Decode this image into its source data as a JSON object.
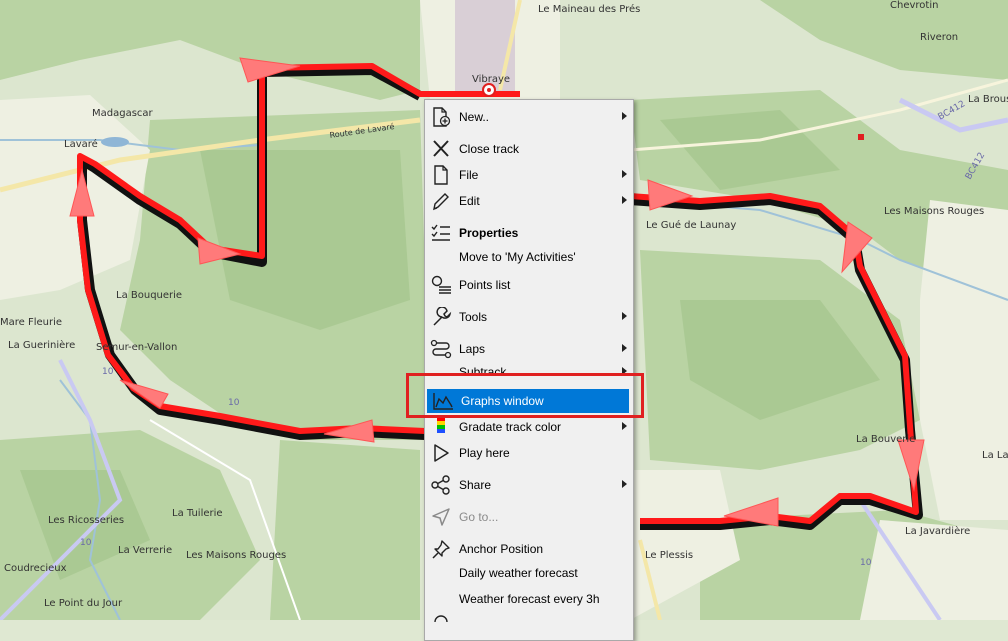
{
  "map": {
    "places": [
      {
        "name": "Le Maineau des Prés"
      },
      {
        "name": "Chevrotin"
      },
      {
        "name": "Riveron"
      },
      {
        "name": "Vibraye"
      },
      {
        "name": "Madagascar"
      },
      {
        "name": "Lavaré"
      },
      {
        "name": "Route de Lavaré"
      },
      {
        "name": "La Brousse"
      },
      {
        "name": "Le Gué de Launay"
      },
      {
        "name": "Les Maisons Rouges"
      },
      {
        "name": "La Bouquerie"
      },
      {
        "name": "Mare Fleurie"
      },
      {
        "name": "La Guerinière"
      },
      {
        "name": "Semur-en-Vallon"
      },
      {
        "name": "La Bouverie"
      },
      {
        "name": "La Lan"
      },
      {
        "name": "La Javardière"
      },
      {
        "name": "Les Ricosseries"
      },
      {
        "name": "La Tuilerie"
      },
      {
        "name": "La Verrerie"
      },
      {
        "name": "Les Maisons Rouges"
      },
      {
        "name": "Coudrecieux"
      },
      {
        "name": "Le Point du Jour"
      },
      {
        "name": "Le Plessis"
      }
    ],
    "road_labels": [
      "BC412",
      "BC412",
      "10",
      "10",
      "10",
      "10"
    ],
    "track_color": "#ff1a1a"
  },
  "menu": {
    "items": [
      {
        "label": "New..",
        "icon": "new-document-icon",
        "submenu": true
      },
      {
        "label": "Close track",
        "icon": "close-icon",
        "submenu": false
      },
      {
        "label": "File",
        "icon": "file-icon",
        "submenu": true
      },
      {
        "label": "Edit",
        "icon": "pencil-icon",
        "submenu": true
      },
      {
        "label": "Properties",
        "icon": "properties-list-icon",
        "submenu": false
      },
      {
        "label": "Move to 'My Activities'",
        "icon": "",
        "submenu": false
      },
      {
        "label": "Points list",
        "icon": "points-list-icon",
        "submenu": false
      },
      {
        "label": "Tools",
        "icon": "wrench-icon",
        "submenu": true
      },
      {
        "label": "Laps",
        "icon": "laps-icon",
        "submenu": true
      },
      {
        "label": "Subtrack",
        "icon": "",
        "submenu": true
      },
      {
        "label": "Graphs window",
        "icon": "graph-icon",
        "submenu": false
      },
      {
        "label": "Gradate track color",
        "icon": "color-gradient-icon",
        "submenu": true
      },
      {
        "label": "Play here",
        "icon": "play-icon",
        "submenu": false
      },
      {
        "label": "Share",
        "icon": "share-icon",
        "submenu": true
      },
      {
        "label": "Go to...",
        "icon": "navigate-arrow-icon",
        "submenu": false
      },
      {
        "label": "Anchor Position",
        "icon": "pin-icon",
        "submenu": false
      },
      {
        "label": "Daily weather forecast",
        "icon": "",
        "submenu": false
      },
      {
        "label": "Weather forecast every 3h",
        "icon": "",
        "submenu": false
      }
    ],
    "selected": "Graphs window",
    "accent_color": "#0078d7",
    "highlight_color": "#e02020"
  }
}
